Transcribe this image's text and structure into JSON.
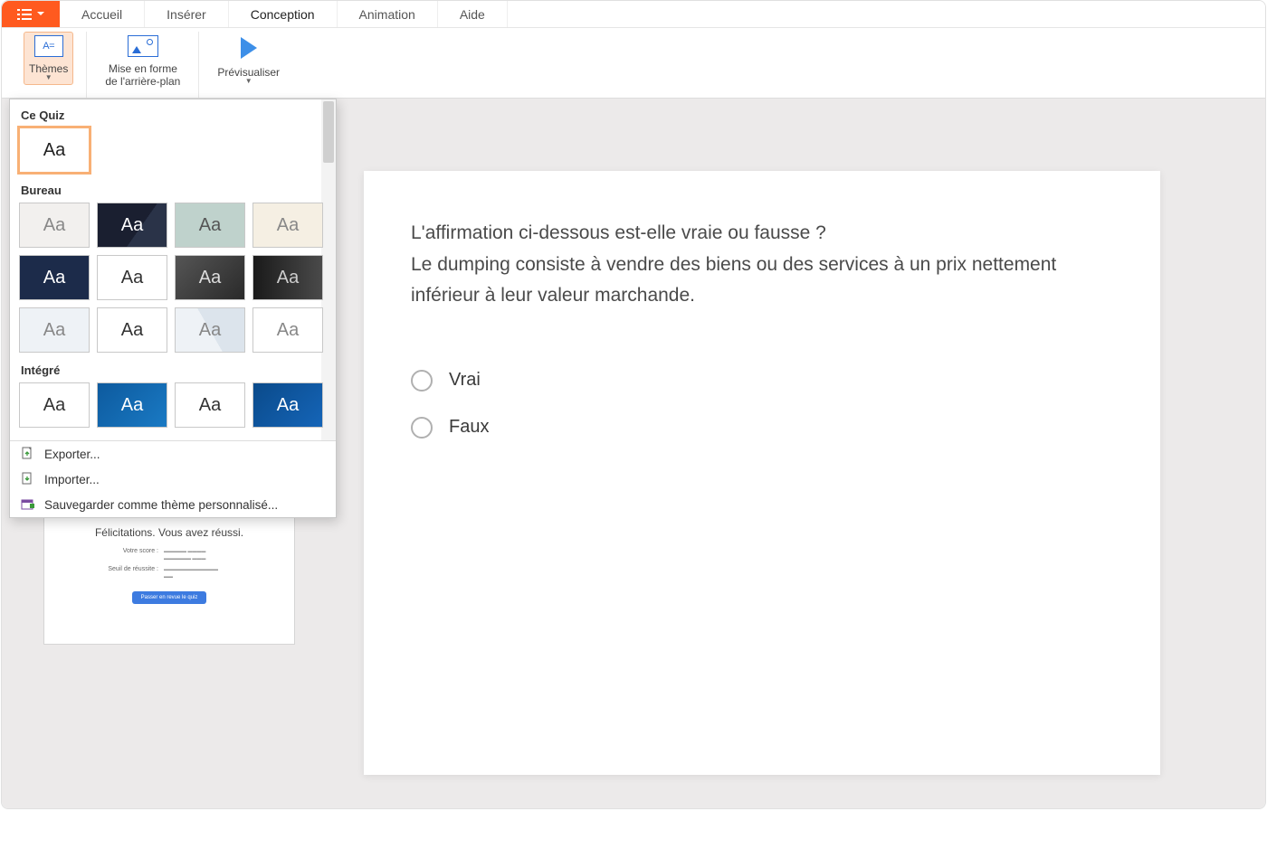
{
  "tabs": {
    "accueil": "Accueil",
    "inserer": "Insérer",
    "conception": "Conception",
    "animation": "Animation",
    "aide": "Aide"
  },
  "ribbon": {
    "themes_glyph": "A=",
    "themes_label": "Thèmes",
    "bg_label_line1": "Mise en forme",
    "bg_label_line2": "de l'arrière-plan",
    "preview_label": "Prévisualiser"
  },
  "themes_panel": {
    "section_ce_quiz": "Ce Quiz",
    "section_bureau": "Bureau",
    "section_integre": "Intégré",
    "swatch_glyph": "Aa",
    "footer_export": "Exporter...",
    "footer_import": "Importer...",
    "footer_save_custom": "Sauvegarder comme thème personnalisé...",
    "ce_quiz": [
      {
        "bg": "#ffffff",
        "fg": "#222222"
      }
    ],
    "bureau": [
      {
        "bg": "#f2f0ee",
        "fg": "#888888"
      },
      {
        "bg": "#1f2433",
        "fg": "#ffffff",
        "style": "navy-geo"
      },
      {
        "bg": "#bfd2cc",
        "fg": "#555555"
      },
      {
        "bg": "#f5efe3",
        "fg": "#888888"
      },
      {
        "bg": "#1c2b4a",
        "fg": "#ffffff"
      },
      {
        "bg": "#ffffff",
        "fg": "#333333"
      },
      {
        "bg": "#3a3a3a",
        "fg": "#dddddd",
        "grad": true
      },
      {
        "bg": "#2a2a2a",
        "fg": "#cccccc",
        "grad2": true
      },
      {
        "bg": "#eef2f6",
        "fg": "#888888"
      },
      {
        "bg": "#ffffff",
        "fg": "#333333"
      },
      {
        "bg": "#f4f4f4",
        "fg": "#888888",
        "poly": true
      },
      {
        "bg": "#ffffff",
        "fg": "#888888"
      }
    ],
    "integre": [
      {
        "bg": "#ffffff",
        "fg": "#333333"
      },
      {
        "bg": "#0d5a9e",
        "fg": "#ffffff",
        "grad3": true
      },
      {
        "bg": "#ffffff",
        "fg": "#333333"
      },
      {
        "bg": "#0a4a8a",
        "fg": "#ffffff",
        "grad4": true
      }
    ]
  },
  "slide": {
    "question_line1": "L'affirmation ci-dessous est-elle vraie ou fausse ?",
    "question_line2": "Le dumping consiste à vendre des biens ou des services à un prix nettement inférieur à leur valeur marchande.",
    "option_true": "Vrai",
    "option_false": "Faux"
  },
  "results_thumb": {
    "title": "Félicitations. Vous avez réussi.",
    "score_label": "Votre score :",
    "threshold_label": "Seuil de réussite :",
    "button": "Passer en revue le quiz"
  }
}
